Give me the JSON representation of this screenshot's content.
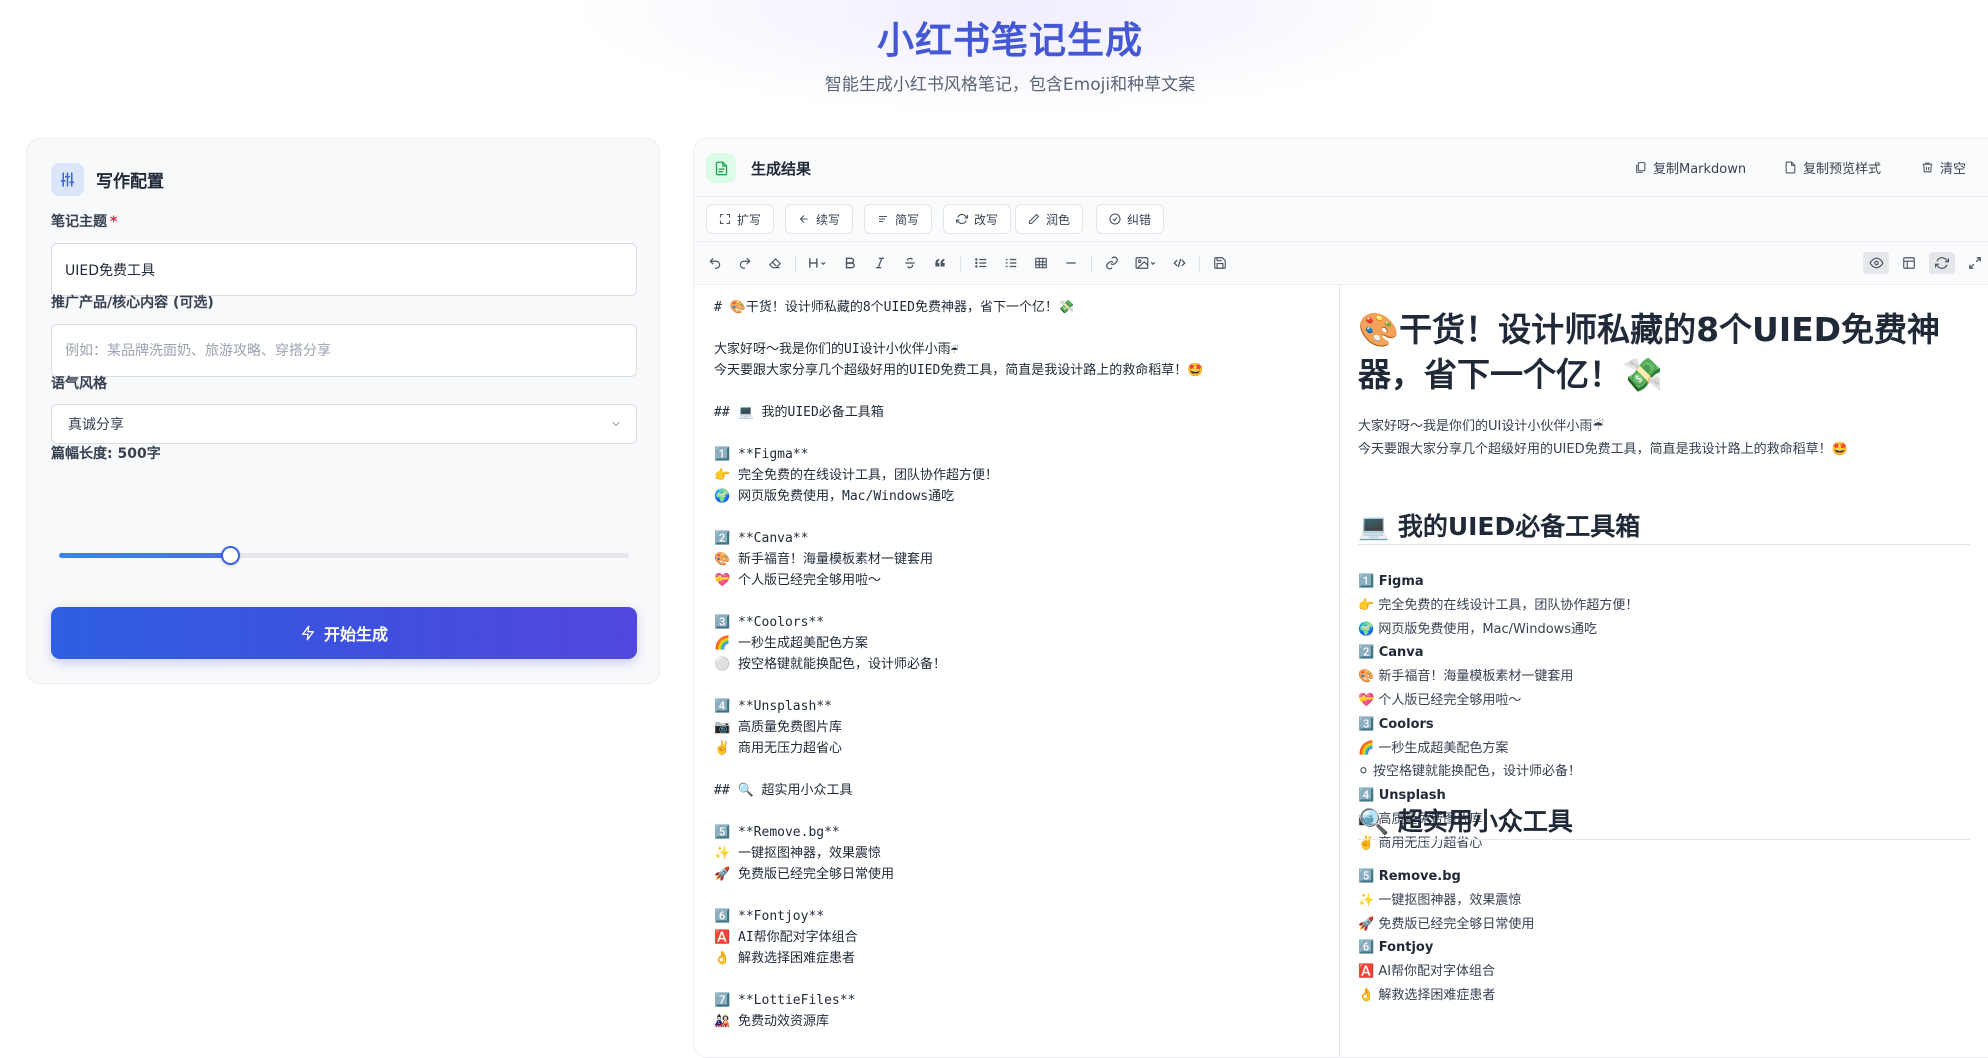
{
  "header": {
    "title": "小红书笔记生成",
    "subtitle": "智能生成小红书风格笔记，包含Emoji和种草文案"
  },
  "config": {
    "title": "写作配置",
    "topic_label": "笔记主题",
    "topic_required": "*",
    "topic_value": "UIED免费工具",
    "product_label": "推广产品/核心内容 (可选)",
    "product_placeholder": "例如：某品牌洗面奶、旅游攻略、穿搭分享",
    "tone_label": "语气风格",
    "tone_value": "真诚分享",
    "length_label": "篇幅长度: 500字",
    "length_slider_fraction": 0.3,
    "generate_label": "开始生成"
  },
  "result": {
    "title": "生成结果",
    "copy_markdown": "复制Markdown",
    "copy_preview": "复制预览样式",
    "clear": "清空",
    "ai_actions": [
      "扩写",
      "续写",
      "简写",
      "改写",
      "润色",
      "纠错"
    ]
  },
  "editor": {
    "lines": [
      "# 🎨干货！设计师私藏的8个UIED免费神器，省下一个亿！💸",
      "",
      "大家好呀～我是你们的UI设计小伙伴小雨☔",
      "今天要跟大家分享几个超级好用的UIED免费工具，简直是我设计路上的救命稻草！🤩",
      "",
      "## 💻 我的UIED必备工具箱",
      "",
      "1️⃣ **Figma**",
      "👉 完全免费的在线设计工具，团队协作超方便！",
      "🌍 网页版免费使用，Mac/Windows通吃",
      "",
      "2️⃣ **Canva**",
      "🎨 新手福音！海量模板素材一键套用",
      "💝 个人版已经完全够用啦～",
      "",
      "3️⃣ **Coolors**",
      "🌈 一秒生成超美配色方案",
      "⚪ 按空格键就能换配色，设计师必备！",
      "",
      "4️⃣ **Unsplash**",
      "📷 高质量免费图片库",
      "✌️ 商用无压力超省心",
      "",
      "## 🔍 超实用小众工具",
      "",
      "5️⃣ **Remove.bg**",
      "✨ 一键抠图神器，效果震惊",
      "🚀 免费版已经完全够日常使用",
      "",
      "6️⃣ **Fontjoy**",
      "🅰️ AI帮你配对字体组合",
      "👌 解救选择困难症患者",
      "",
      "7️⃣ **LottieFiles**",
      "🎎 免费动效资源库"
    ]
  },
  "preview": {
    "h1": "🎨干货！设计师私藏的8个UIED免费神器，省下一个亿！💸",
    "intro_1": "大家好呀～我是你们的UI设计小伙伴小雨☔",
    "intro_2": "今天要跟大家分享几个超级好用的UIED免费工具，简直是我设计路上的救命稻草！🤩",
    "h2_1": "💻 我的UIED必备工具箱",
    "list_1": [
      {
        "text": "1️⃣ Figma",
        "bold": true
      },
      {
        "text": "👉 完全免费的在线设计工具，团队协作超方便！",
        "bold": false
      },
      {
        "text": "🌍 网页版免费使用，Mac/Windows通吃",
        "bold": false
      },
      {
        "text": "2️⃣ Canva",
        "bold": true
      },
      {
        "text": "🎨 新手福音！海量模板素材一键套用",
        "bold": false
      },
      {
        "text": "💝 个人版已经完全够用啦～",
        "bold": false
      },
      {
        "text": "3️⃣ Coolors",
        "bold": true
      },
      {
        "text": "🌈 一秒生成超美配色方案",
        "bold": false
      },
      {
        "text": "⚪ 按空格键就能换配色，设计师必备！",
        "bold": false
      },
      {
        "text": "4️⃣ Unsplash",
        "bold": true
      },
      {
        "text": "📷 高质量免费图片库",
        "bold": false
      },
      {
        "text": "✌️ 商用无压力超省心",
        "bold": false
      }
    ],
    "h2_2": "🔍 超实用小众工具",
    "list_2": [
      {
        "text": "5️⃣ Remove.bg",
        "bold": true
      },
      {
        "text": "✨ 一键抠图神器，效果震惊",
        "bold": false
      },
      {
        "text": "🚀 免费版已经完全够日常使用",
        "bold": false
      },
      {
        "text": "6️⃣ Fontjoy",
        "bold": true
      },
      {
        "text": "🅰️ AI帮你配对字体组合",
        "bold": false
      },
      {
        "text": "👌 解救选择困难症患者",
        "bold": false
      }
    ]
  },
  "colors": {
    "title_blue": "#4458d6",
    "button_gradient_start": "#2f5fe3",
    "button_gradient_end": "#5246de",
    "slider_fill": "#3b63e6"
  }
}
